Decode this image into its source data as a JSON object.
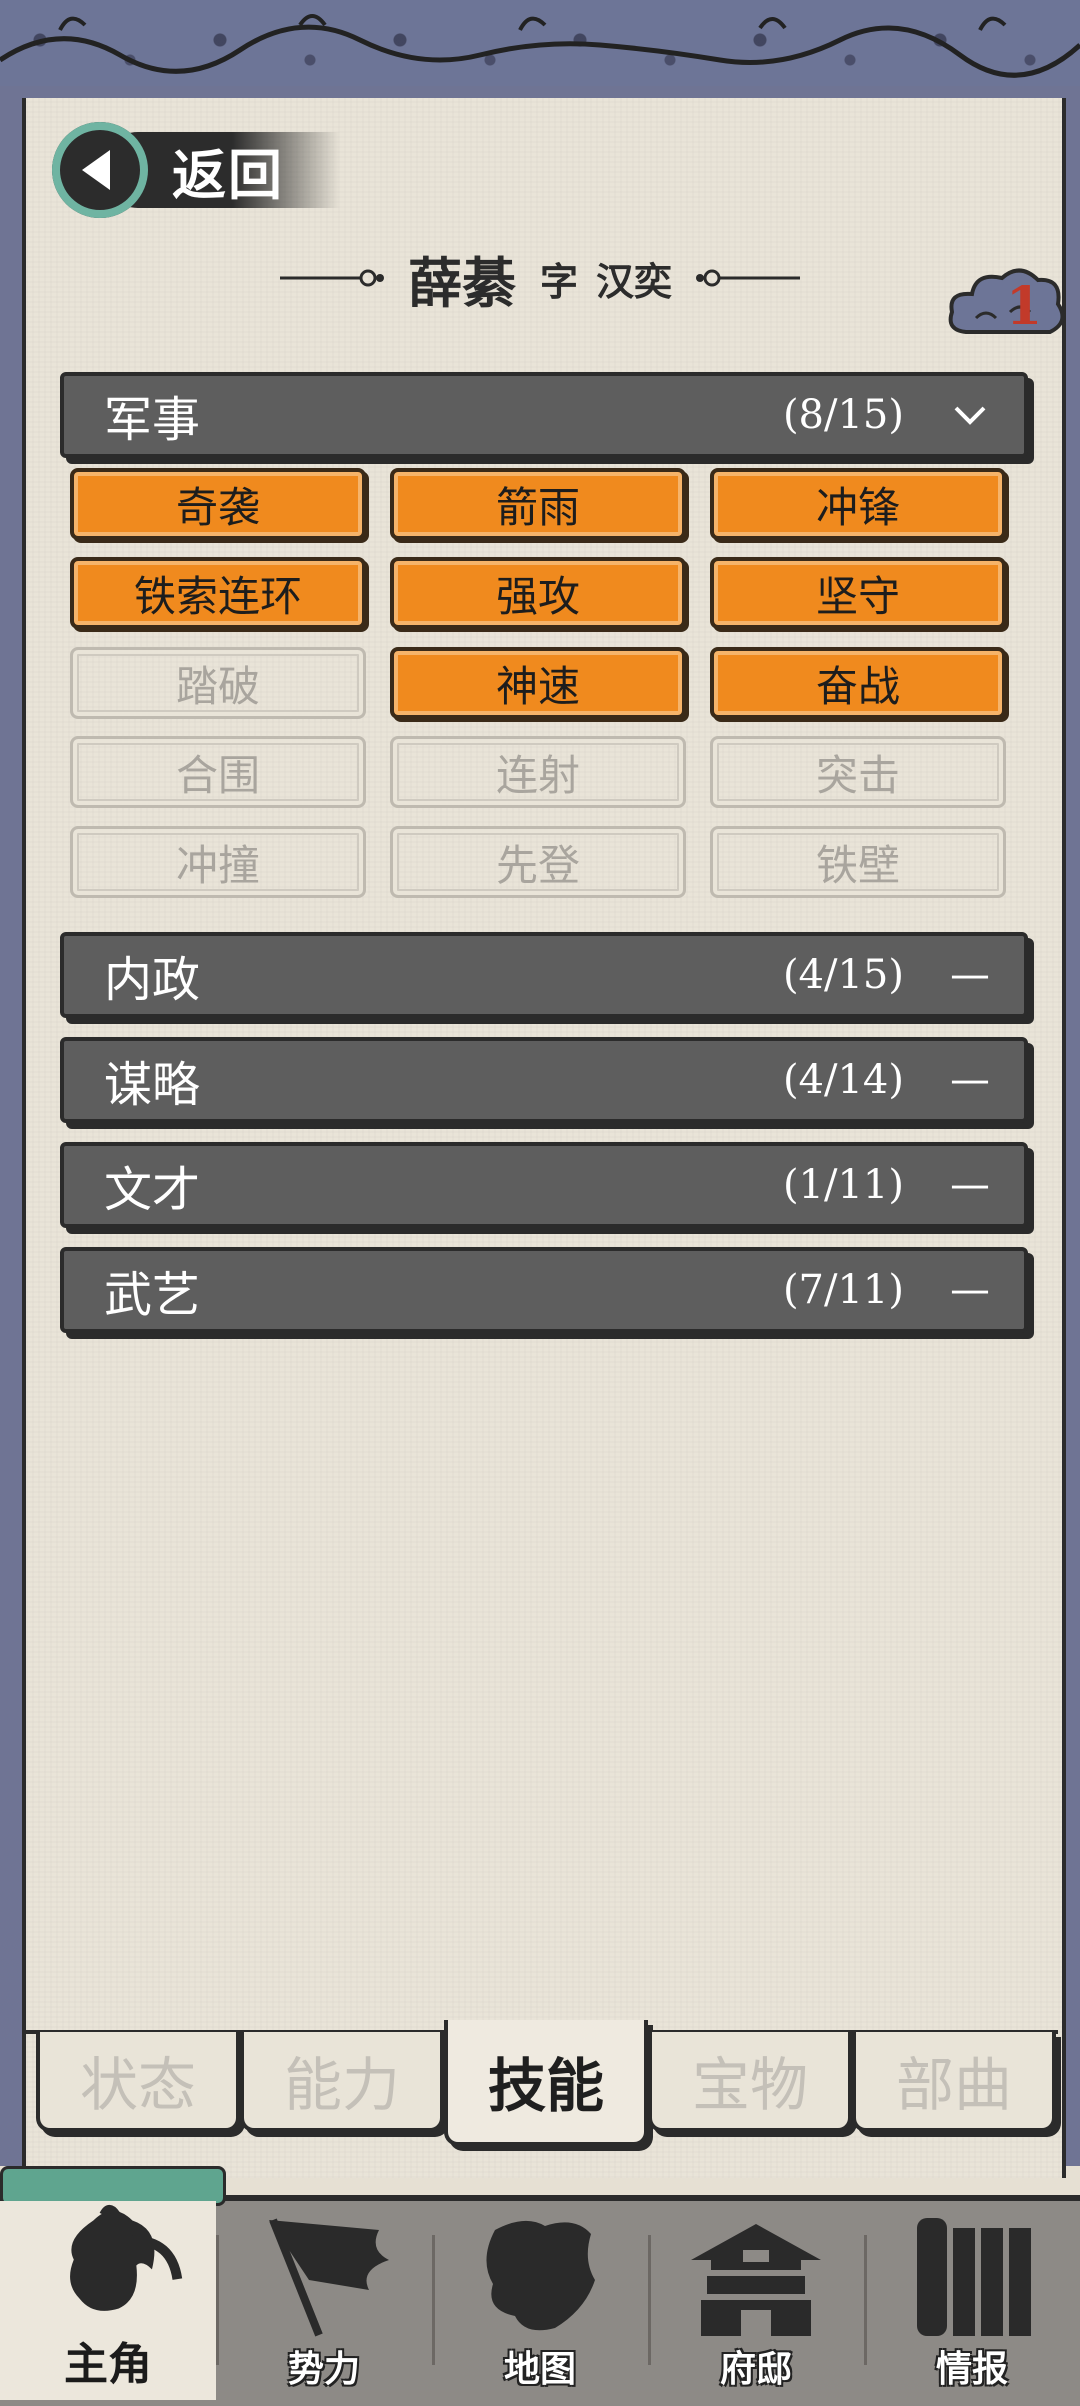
{
  "header": {
    "back_label": "返回",
    "name": "薛綦",
    "zi_label": "字",
    "courtesy_name": "汉奕",
    "badge_count": "1"
  },
  "sections": [
    {
      "title": "军事",
      "count": "(8/15)",
      "toggle": "﹀",
      "expanded": true,
      "skills": [
        {
          "label": "奇袭",
          "unlocked": true
        },
        {
          "label": "箭雨",
          "unlocked": true
        },
        {
          "label": "冲锋",
          "unlocked": true
        },
        {
          "label": "铁索连环",
          "unlocked": true
        },
        {
          "label": "强攻",
          "unlocked": true
        },
        {
          "label": "坚守",
          "unlocked": true
        },
        {
          "label": "踏破",
          "unlocked": false
        },
        {
          "label": "神速",
          "unlocked": true
        },
        {
          "label": "奋战",
          "unlocked": true
        },
        {
          "label": "合围",
          "unlocked": false
        },
        {
          "label": "连射",
          "unlocked": false
        },
        {
          "label": "突击",
          "unlocked": false
        },
        {
          "label": "冲撞",
          "unlocked": false
        },
        {
          "label": "先登",
          "unlocked": false
        },
        {
          "label": "铁壁",
          "unlocked": false
        }
      ]
    },
    {
      "title": "内政",
      "count": "(4/15)",
      "toggle": "—",
      "expanded": false
    },
    {
      "title": "谋略",
      "count": "(4/14)",
      "toggle": "—",
      "expanded": false
    },
    {
      "title": "文才",
      "count": "(1/11)",
      "toggle": "—",
      "expanded": false
    },
    {
      "title": "武艺",
      "count": "(7/11)",
      "toggle": "—",
      "expanded": false
    }
  ],
  "tabs": [
    {
      "label": "状态",
      "active": false
    },
    {
      "label": "能力",
      "active": false
    },
    {
      "label": "技能",
      "active": true
    },
    {
      "label": "宝物",
      "active": false
    },
    {
      "label": "部曲",
      "active": false
    }
  ],
  "nav": [
    {
      "label": "主角",
      "icon": "hero-icon",
      "active": true
    },
    {
      "label": "势力",
      "icon": "flag-icon",
      "active": false
    },
    {
      "label": "地图",
      "icon": "map-icon",
      "active": false
    },
    {
      "label": "府邸",
      "icon": "mansion-icon",
      "active": false
    },
    {
      "label": "情报",
      "icon": "scroll-icon",
      "active": false
    }
  ],
  "colors": {
    "skill_on": "#f08a1e",
    "section_bg": "#5e5e5e",
    "frame": "#6f7494",
    "accent_teal": "#6fb4a2"
  }
}
